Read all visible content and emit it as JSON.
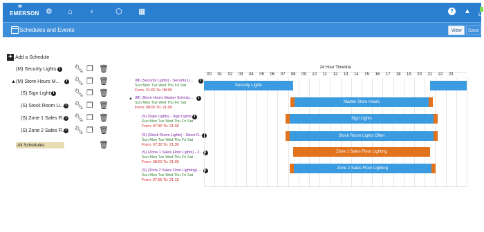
{
  "header": {
    "brand": "EMERSON",
    "user_label": "Lo"
  },
  "subheader": {
    "title": "Schedules and Events",
    "view_label": "View",
    "save_label": "Save"
  },
  "sidebar": {
    "add_label": "Add a Schedule",
    "items": [
      {
        "label": "(M) Security Lights"
      },
      {
        "label": "(M) Store Hours M..."
      },
      {
        "label": "(S) Sign Lights"
      },
      {
        "label": "(S) Stock Room Li..."
      },
      {
        "label": "(S) Zone 1 Sales Fl..."
      },
      {
        "label": "(S) Zone 2 Sales Fl..."
      }
    ],
    "all_schedules": "All Schedules"
  },
  "timeline": {
    "title": "24 Hour Timeline",
    "hours": [
      "00",
      "01",
      "02",
      "03",
      "04",
      "05",
      "06",
      "07",
      "08",
      "09",
      "10",
      "11",
      "12",
      "13",
      "14",
      "15",
      "16",
      "17",
      "18",
      "19",
      "20",
      "21",
      "22",
      "23"
    ],
    "rows": [
      {
        "name": "(M) (Security Lights) - Security Li...",
        "days": "Sun Mon Tue Wed Thu Fri Sat",
        "time": "From: 21:00 To: 08:00"
      },
      {
        "name": "(M) (Store Hours Master Schedu...",
        "days": "Sun Mon Tue Wed Thu Fri Sat",
        "time": "From: 08:00 To: 21:00"
      },
      {
        "name": "(S) (Sign Lights) - Sign Lights",
        "days": "Sun Mon Tue Wed Thu Fri Sat",
        "time": "From: 07:30 To: 21:30"
      },
      {
        "name": "(S) (Stock Room Lights) - Stock R...",
        "days": "Sun Mon Tue Wed Thu Fri Sat",
        "time": "From: 07:30 To: 21:30"
      },
      {
        "name": "(S) (Zone 1 Sales Floor Lights) - Z...",
        "days": "Sun Mon Tue Wed Thu Fri Sat",
        "time": "From: 08:00 To: 21:00"
      },
      {
        "name": "(S) (Zone 2 Sales Floor Lighting) -...",
        "days": "Sun Mon Tue Wed Thu Fri Sat",
        "time": "From: 07:55 To: 21:15"
      }
    ],
    "bars": [
      {
        "label": "Security Lights",
        "start": 21,
        "end": 8,
        "color": "#3b9be0"
      },
      {
        "label": "Master Store Hours",
        "start": 8,
        "end": 21,
        "color": "#3b9be0"
      },
      {
        "label": "Sign Lights",
        "start": 7.5,
        "end": 21.5,
        "color": "#3b9be0"
      },
      {
        "label": "Stock Room Lights Often",
        "start": 7.5,
        "end": 21.5,
        "color": "#3b9be0"
      },
      {
        "label": "Zone 1 Sales Floor Lighting",
        "start": 8,
        "end": 21,
        "color": "#e2731d"
      },
      {
        "label": "Zone 2 Sales Floor Lighting",
        "start": 7.92,
        "end": 21.25,
        "color": "#3b9be0"
      }
    ]
  },
  "colors": {
    "header": "#2b7fd1",
    "bar_blue": "#3b9be0",
    "bar_orange": "#e2731d"
  }
}
